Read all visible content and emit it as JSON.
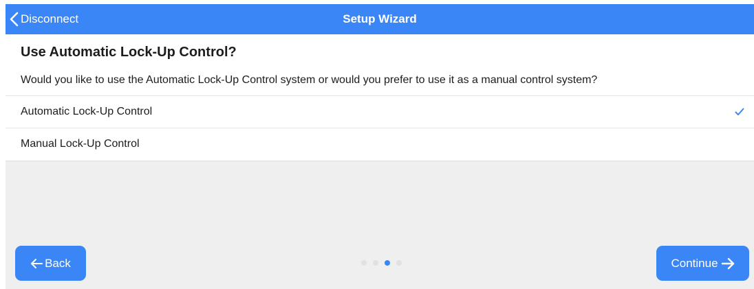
{
  "navbar": {
    "back_label": "Disconnect",
    "title": "Setup Wizard",
    "back_icon": "chevron-left-icon"
  },
  "question": {
    "title": "Use Automatic Lock-Up Control?",
    "description": "Would you like to use the Automatic Lock-Up Control system or would you prefer to use it as a manual control system?"
  },
  "options": [
    {
      "label": "Automatic Lock-Up Control",
      "selected": true
    },
    {
      "label": "Manual Lock-Up Control",
      "selected": false
    }
  ],
  "footer": {
    "back_label": "Back",
    "continue_label": "Continue",
    "pager": {
      "total": 4,
      "current": 3
    }
  },
  "colors": {
    "accent": "#3b86f6",
    "background": "#efefef",
    "text": "#1c1c1e",
    "dot_inactive": "#e1e1e4"
  }
}
